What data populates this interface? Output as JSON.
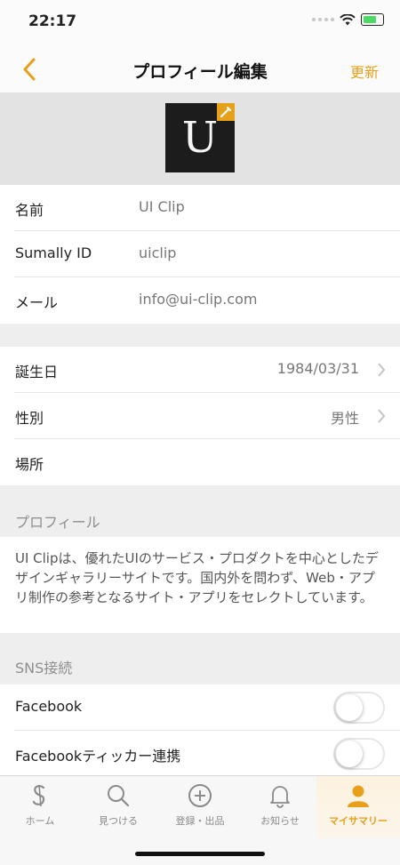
{
  "status": {
    "time": "22:17"
  },
  "nav": {
    "title": "プロフィール編集",
    "update_label": "更新"
  },
  "avatar": {
    "letter": "U"
  },
  "fields": [
    {
      "label": "名前",
      "value": "UI Clip"
    },
    {
      "label": "Sumally ID",
      "value": "uiclip"
    },
    {
      "label": "メール",
      "value": "info@ui-clip.com"
    }
  ],
  "details": [
    {
      "label": "誕生日",
      "value": "1984/03/31"
    },
    {
      "label": "性別",
      "value": "男性"
    },
    {
      "label": "場所",
      "value": ""
    }
  ],
  "profile": {
    "header": "プロフィール",
    "text": "UI Clipは、優れたUIのサービス・プロダクトを中心としたデザインギャラリーサイトです。国内外を問わず、Web・アプリ制作の参考となるサイト・アプリをセレクトしています。"
  },
  "sns": {
    "header": "SNS接続",
    "items": [
      {
        "label": "Facebook",
        "enabled": false
      },
      {
        "label": "Facebookティッカー連携",
        "enabled": false
      }
    ]
  },
  "tabs": [
    {
      "label": "ホーム",
      "icon": "sumally-logo-icon"
    },
    {
      "label": "見つける",
      "icon": "search-icon"
    },
    {
      "label": "登録・出品",
      "icon": "add-circle-icon"
    },
    {
      "label": "お知らせ",
      "icon": "bell-icon"
    },
    {
      "label": "マイサマリー",
      "icon": "person-icon",
      "active": true
    }
  ],
  "colors": {
    "accent": "#e7a01a",
    "section_background": "#eeeeee"
  }
}
